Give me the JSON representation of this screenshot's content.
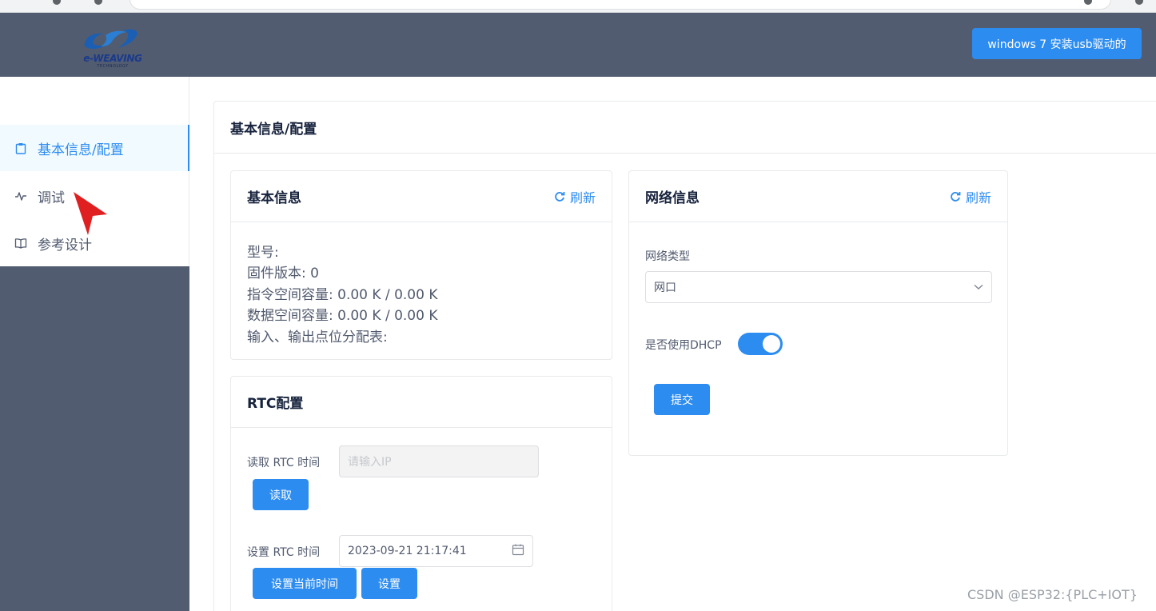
{
  "header": {
    "logo_text": "e-WEAVING",
    "logo_sub": "TECHNOLOGY",
    "driver_button": "windows 7 安装usb驱动的"
  },
  "sidebar": {
    "items": [
      {
        "label": "基本信息/配置",
        "icon": "clipboard-icon",
        "active": true
      },
      {
        "label": "调试",
        "icon": "pulse-icon",
        "active": false
      },
      {
        "label": "参考设计",
        "icon": "book-icon",
        "active": false
      }
    ]
  },
  "main": {
    "title": "基本信息/配置",
    "basic_info": {
      "title": "基本信息",
      "refresh_label": "刷新",
      "lines": [
        "型号:",
        "固件版本:  0",
        "指令空间容量:  0.00 K / 0.00 K",
        "数据空间容量:  0.00 K / 0.00 K",
        "输入、输出点位分配表:"
      ]
    },
    "rtc": {
      "title": "RTC配置",
      "read_label": "读取 RTC 时间",
      "read_placeholder": "请输入IP",
      "read_button": "读取",
      "set_label": "设置 RTC 时间",
      "set_value": "2023-09-21 21:17:41",
      "set_now_button": "设置当前时间",
      "set_button": "设置"
    },
    "network": {
      "title": "网络信息",
      "refresh_label": "刷新",
      "type_label": "网络类型",
      "type_value": "网口",
      "dhcp_label": "是否使用DHCP",
      "dhcp_enabled": true,
      "submit_button": "提交"
    }
  },
  "watermark": "CSDN @ESP32:{PLC+IOT}",
  "colors": {
    "header_bg": "#525c70",
    "accent": "#2d8cf0",
    "active_bg": "#f0faff"
  }
}
